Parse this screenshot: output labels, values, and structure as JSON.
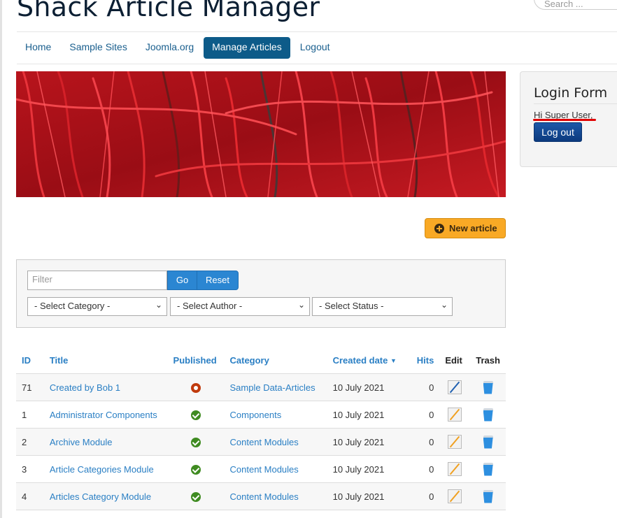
{
  "site": {
    "title": "Shack Article Manager",
    "search_placeholder": "Search ..."
  },
  "nav": {
    "items": [
      {
        "label": "Home",
        "active": false
      },
      {
        "label": "Sample Sites",
        "active": false
      },
      {
        "label": "Joomla.org",
        "active": false
      },
      {
        "label": "Manage Articles",
        "active": true
      },
      {
        "label": "Logout",
        "active": false
      }
    ]
  },
  "login": {
    "title": "Login Form",
    "greeting": "Hi Super User,",
    "logout_label": "Log out"
  },
  "toolbar": {
    "new_article_label": "New article"
  },
  "filters": {
    "filter_placeholder": "Filter",
    "go_label": "Go",
    "reset_label": "Reset",
    "category": "- Select Category -",
    "author": "- Select Author -",
    "status": "- Select Status -"
  },
  "table": {
    "headers": {
      "id": "ID",
      "title": "Title",
      "published": "Published",
      "category": "Category",
      "created": "Created date",
      "hits": "Hits",
      "edit": "Edit",
      "trash": "Trash"
    },
    "rows": [
      {
        "id": "71",
        "title": "Created by Bob 1",
        "published": "unpublished",
        "category": "Sample Data-Articles",
        "created": "10 July 2021",
        "hits": "0"
      },
      {
        "id": "1",
        "title": "Administrator Components",
        "published": "published",
        "category": "Components",
        "created": "10 July 2021",
        "hits": "0"
      },
      {
        "id": "2",
        "title": "Archive Module",
        "published": "published",
        "category": "Content Modules",
        "created": "10 July 2021",
        "hits": "0"
      },
      {
        "id": "3",
        "title": "Article Categories Module",
        "published": "published",
        "category": "Content Modules",
        "created": "10 July 2021",
        "hits": "0"
      },
      {
        "id": "4",
        "title": "Articles Category Module",
        "published": "published",
        "category": "Content Modules",
        "created": "10 July 2021",
        "hits": "0"
      }
    ]
  }
}
